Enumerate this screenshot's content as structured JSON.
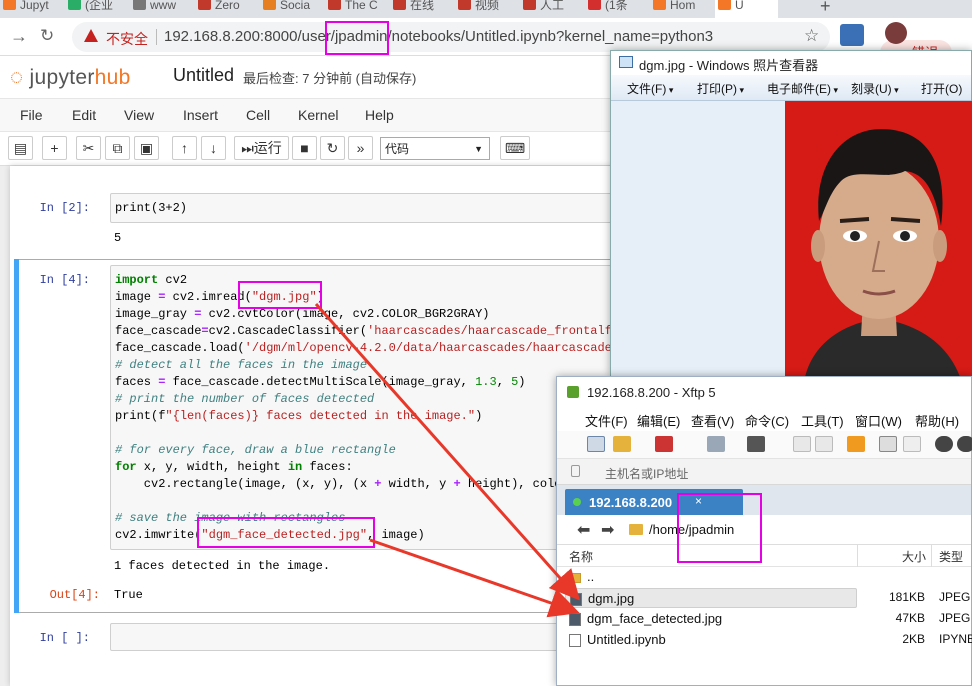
{
  "browser": {
    "tabs": [
      {
        "label": "Jupyt",
        "color": "#f37726"
      },
      {
        "label": "(企业",
        "color": "#2aae67"
      },
      {
        "label": "www",
        "color": "#777777"
      },
      {
        "label": "Zero",
        "color": "#c0392b"
      },
      {
        "label": "Socia",
        "color": "#e67e22"
      },
      {
        "label": "The C",
        "color": "#c0392b"
      },
      {
        "label": "在线",
        "color": "#c0392b"
      },
      {
        "label": "视频",
        "color": "#c0392b"
      },
      {
        "label": "人工",
        "color": "#c0392b"
      },
      {
        "label": "(1条",
        "color": "#d32f2f"
      },
      {
        "label": "Hom",
        "color": "#f37726"
      },
      {
        "label": "U",
        "color": "#f37726"
      }
    ],
    "new_tab": "+",
    "security": "不安全",
    "url": "192.168.8.200:8000/user/jpadmin/notebooks/Untitled.ipynb?kernel_name=python3",
    "error_button": "错误"
  },
  "jupyter": {
    "logo_main": "jupyter",
    "logo_hub": "hub",
    "notebook_name": "Untitled",
    "checkpoint": "最后检查: 7 分钟前 (自动保存)",
    "menu": [
      "File",
      "Edit",
      "View",
      "Insert",
      "Cell",
      "Kernel",
      "Help"
    ],
    "run_label": "运行",
    "cell_type": "代码",
    "cells": [
      {
        "prompt": "In  [2]:",
        "code": "print(3+2)",
        "output": "5"
      },
      {
        "prompt": "In  [4]:",
        "output_stream": "1 faces detected in the image.",
        "out_prompt": "Out[4]:",
        "output": "True"
      },
      {
        "prompt": "In  [ ]:"
      }
    ],
    "code_lines": [
      "import cv2",
      "image = cv2.imread(\"dgm.jpg\")",
      "image_gray = cv2.cvtColor(image, cv2.COLOR_BGR2GRAY)",
      "face_cascade=cv2.CascadeClassifier('haarcascades/haarcascade_frontalface_",
      "face_cascade.load('/dgm/ml/opencv-4.2.0/data/haarcascades/haarcascade_fro",
      "# detect all the faces in the image",
      "faces = face_cascade.detectMultiScale(image_gray, 1.3, 5)",
      "# print the number of faces detected",
      "print(f\"{len(faces)} faces detected in the image.\")",
      "",
      "# for every face, draw a blue rectangle",
      "for x, y, width, height in faces:",
      "    cv2.rectangle(image, (x, y), (x + width, y + height), color",
      "",
      "# save the image with rectangles",
      "cv2.imwrite(\"dgm_face_detected.jpg\", image)"
    ]
  },
  "viewer": {
    "title": "dgm.jpg - Windows 照片查看器",
    "menu": [
      "文件(F)",
      "打印(P)",
      "电子邮件(E)",
      "刻录(U)",
      "打开(O)"
    ]
  },
  "xftp": {
    "title": "192.168.8.200   - Xftp 5",
    "menu": [
      "文件(F)",
      "编辑(E)",
      "查看(V)",
      "命令(C)",
      "工具(T)",
      "窗口(W)",
      "帮助(H)"
    ],
    "host_placeholder": "主机名或IP地址",
    "tab_label": "192.168.8.200",
    "tab_close": "×",
    "path": "/home/jpadmin",
    "columns": {
      "name": "名称",
      "size": "大小",
      "type": "类型"
    },
    "files": [
      {
        "name": "..",
        "size": "",
        "type": "",
        "kind": "dir"
      },
      {
        "name": "dgm.jpg",
        "size": "181KB",
        "type": "JPEG",
        "kind": "img"
      },
      {
        "name": "dgm_face_detected.jpg",
        "size": "47KB",
        "type": "JPEG",
        "kind": "img"
      },
      {
        "name": "Untitled.ipynb",
        "size": "2KB",
        "type": "IPYNB",
        "kind": "file"
      }
    ]
  },
  "colors": {
    "highlight": "#e600e6",
    "arrow": "#e8382a",
    "jupyter_orange": "#f37726"
  }
}
